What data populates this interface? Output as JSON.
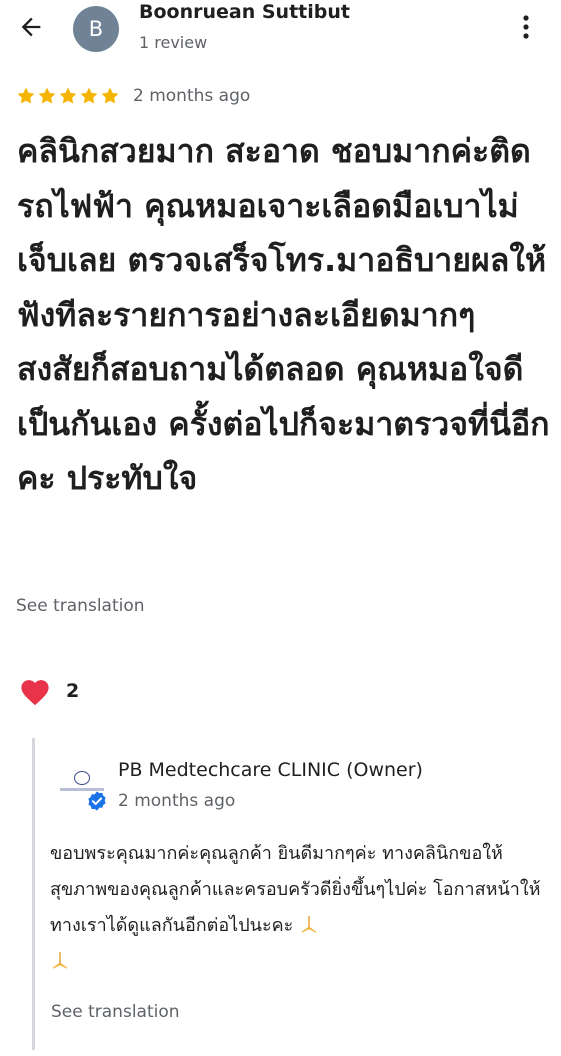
{
  "header": {
    "avatar_letter": "B",
    "author_name": "Boonruean Suttibut",
    "author_meta": "1 review",
    "back_icon": "arrow-left-icon",
    "more_icon": "more-vert-icon"
  },
  "review": {
    "rating": 5,
    "max_rating": 5,
    "star_color": "#f4b400",
    "date": "2 months ago",
    "text": "คลินิกสวยมาก สะอาด ชอบมากค่ะติดรถไฟฟ้า คุณหมอเจาะเลือดมือเบาไม่เจ็บเลย ตรวจเสร็จโทร.มาอธิบายผลให้ฟังทีละรายการอย่างละเอียดมากๆ สงสัยก็สอบถามได้ตลอด คุณหมอใจดีเป็นกันเอง ครั้งต่อไปก็จะมาตรวจที่นี่อีกคะ ประทับใจ",
    "see_translation": "See translation"
  },
  "reactions": {
    "icon": "heart-icon",
    "count": "2"
  },
  "owner_reply": {
    "logo_icon": "clinic-logo-icon",
    "verified_icon": "verified-badge-icon",
    "name": "PB Medtechcare CLINIC (Owner)",
    "date": "2 months ago",
    "text": "ขอบพระคุณมากค่ะคุณลูกค้า ยินดีมากๆค่ะ ทางคลินิกขอให้สุขภาพของคุณลูกค้าและครอบครัวดียิ่งขึ้นๆไปค่ะ โอกาสหน้าให้ทางเราได้ดูแลกันอีกต่อไปนะคะ",
    "see_translation": "See translation"
  },
  "colors": {
    "accent_blue": "#1a73e8",
    "heart_red": "#e8334a",
    "secondary_text": "#5f6368",
    "avatar_bg": "#6f8296"
  }
}
